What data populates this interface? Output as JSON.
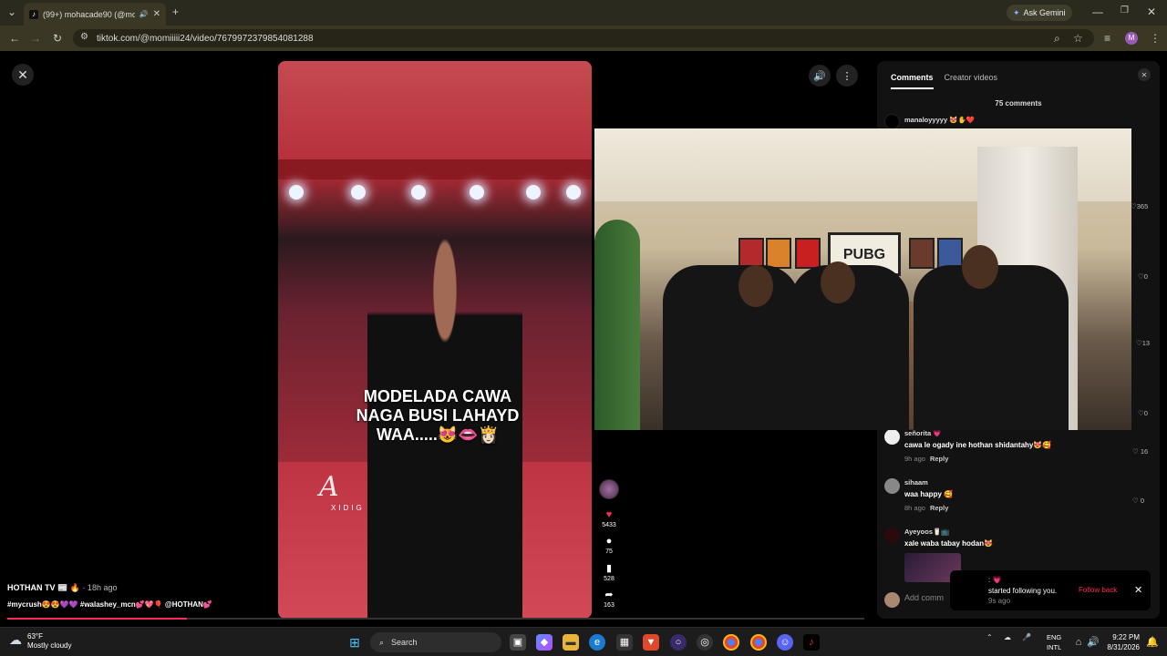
{
  "browser": {
    "tab_title": "(99+) mohacade90 (@moh...",
    "url": "tiktok.com/@momiiiii24/video/7679972379854081288",
    "gemini_label": "Ask Gemini",
    "profile_letter": "M"
  },
  "video": {
    "caption_lines": [
      "MODELADA CAWA",
      "NAGA BUSI LAHAYD",
      "WAA.....😻👄👸🏻"
    ],
    "watermark": "A",
    "watermark_sub": "XIDIG",
    "likes": "5433",
    "comments": "75",
    "saves": "528",
    "shares": "163",
    "progress": 0.21
  },
  "post": {
    "author": "HOTHAN TV 📰 🔥",
    "time": "· 18h ago",
    "tags": "#mycrush😍😍💜💜 #walashey_mcn💕💖🎈 @HOTHAN💕"
  },
  "panel": {
    "tab_comments": "Comments",
    "tab_creator": "Creator videos",
    "comment_count": "75 comments",
    "first_user": "manaloyyyyy 😻✋❤️",
    "side_likes": [
      "365",
      "0",
      "13",
      "0"
    ],
    "comments": [
      {
        "user": "señorita 💗",
        "text": "cawa le ogady ine hothan shidantahy😻🥰",
        "time": "9h ago",
        "reply": "Reply",
        "likes": "16"
      },
      {
        "user": "sihaam",
        "text": "waa happy 🥰",
        "time": "8h ago",
        "reply": "Reply",
        "likes": "0"
      },
      {
        "user": "Ayeyoos🥛📺",
        "text": "xale waba tabay hodan😻",
        "time": "",
        "reply": "",
        "likes": ""
      }
    ],
    "add_comment_placeholder": "Add comm"
  },
  "overlay": {
    "sign_text": "PUBG"
  },
  "toast": {
    "line1": ": 💗",
    "line2": "started following you.",
    "line3": "9s ago",
    "follow_back": "Follow back"
  },
  "taskbar": {
    "temp": "63°F",
    "weather": "Mostly cloudy",
    "search": "Search",
    "lang1": "ENG",
    "lang2": "INTL",
    "time": "9:22 PM",
    "date": "8/31/2026"
  }
}
